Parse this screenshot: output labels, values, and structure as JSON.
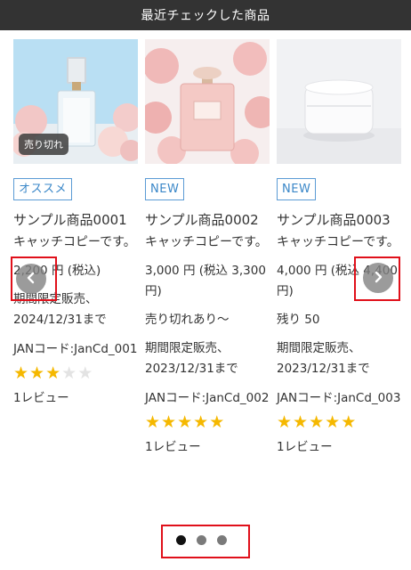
{
  "header": {
    "title": "最近チェックした商品"
  },
  "products": [
    {
      "badge": "オススメ",
      "sold_out_label": "売り切れ",
      "name": "サンプル商品0001",
      "catch_copy": "キャッチコピーです。",
      "price": "2,200 円 (税込)",
      "period": "期間限定販売、2024/12/31まで",
      "jan": "JANコード:JanCd_001",
      "rating": 3,
      "reviews": "1レビュー"
    },
    {
      "badge": "NEW",
      "name": "サンプル商品0002",
      "catch_copy": "キャッチコピーです。",
      "price": "3,000 円 (税込 3,300 円)",
      "stock": "売り切れあり～",
      "period": "期間限定販売、2023/12/31まで",
      "jan": "JANコード:JanCd_002",
      "rating": 5,
      "reviews": "1レビュー"
    },
    {
      "badge": "NEW",
      "name": "サンプル商品0003",
      "catch_copy": "キャッチコピーです。",
      "price": "4,000 円 (税込 4,400 円)",
      "stock": "残り 50",
      "period": "期間限定販売、2023/12/31まで",
      "jan": "JANコード:JanCd_003",
      "rating": 5,
      "reviews": "1レビュー"
    }
  ],
  "pagination": {
    "pages": 3,
    "current": 1
  },
  "colors": {
    "header_bg": "#333333",
    "badge": "#3a87c8",
    "star": "#f5b800",
    "highlight": "#e0101a"
  },
  "icons": {
    "prev": "chevron-left-icon",
    "next": "chevron-right-icon",
    "star": "star-icon"
  }
}
